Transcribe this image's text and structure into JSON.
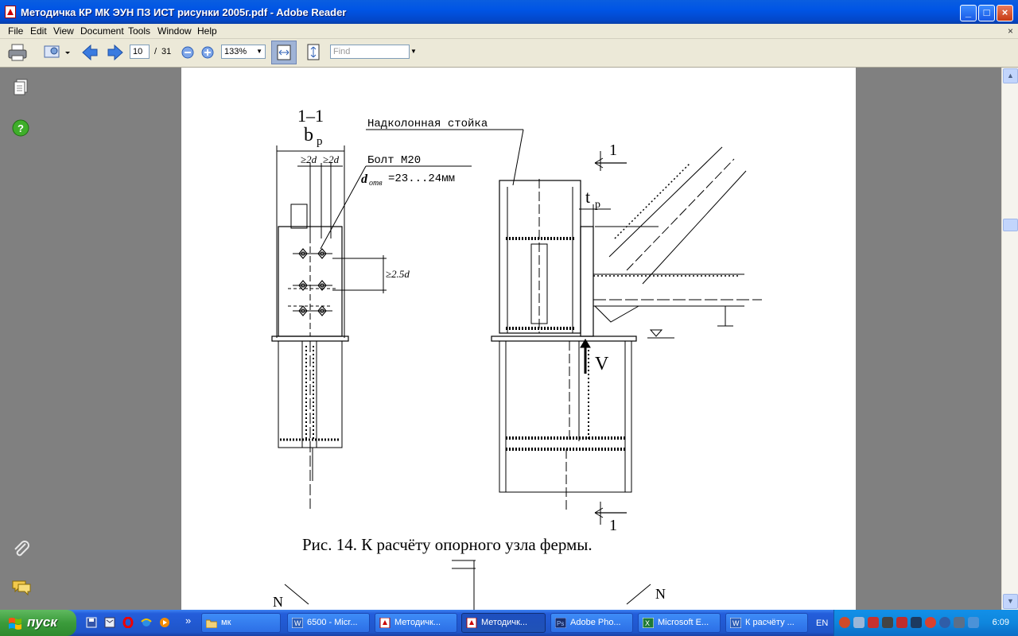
{
  "window": {
    "title": "Методичка КР МК ЭУН ПЗ ИСТ рисунки 2005г.pdf - Adobe Reader",
    "minimize_glyph": "_",
    "maximize_glyph": "□",
    "close_glyph": "×"
  },
  "menu": {
    "items": [
      "File",
      "Edit",
      "View",
      "Document",
      "Tools",
      "Window",
      "Help"
    ],
    "close_glyph": "×"
  },
  "toolbar": {
    "page_current": "10",
    "page_sep": "/",
    "page_total": "31",
    "zoom": "133%",
    "find_placeholder": "Find"
  },
  "drawing": {
    "section_label": "1–1",
    "width_label": "b",
    "width_sub": "p",
    "spacing_a": "≥2d",
    "spacing_b": "≥2d",
    "bolt_label": "Болт М20",
    "hole_symbol": "d",
    "hole_sub": "отв",
    "hole_value": "=23...24мм",
    "vertical_spacing": "≥2.5d",
    "column_label": "Надколонная стойка",
    "section_mark_top": "1",
    "section_mark_bottom": "1",
    "plate_thickness": "t",
    "plate_thickness_sub": "p",
    "force_v": "V",
    "force_n_left": "N",
    "force_n_right": "N",
    "caption": "Рис. 14. К расчёту опорного узла фермы."
  },
  "taskbar": {
    "start_label": "пуск",
    "quicklaunch_more": "»",
    "tasks": [
      {
        "label": "мк"
      },
      {
        "label": "6500 - Micr..."
      },
      {
        "label": "Методичк..."
      },
      {
        "label": "Методичк..."
      },
      {
        "label": "Adobe Pho..."
      },
      {
        "label": "Microsoft E..."
      },
      {
        "label": "К расчёту ..."
      }
    ],
    "language": "EN",
    "clock": "6:09"
  },
  "colors": {
    "titlebar": "#0055e5",
    "chrome": "#ece9d8",
    "workspace": "#808080",
    "taskbar": "#245edb",
    "start": "#3b9b3b",
    "tray": "#0f86dd"
  }
}
